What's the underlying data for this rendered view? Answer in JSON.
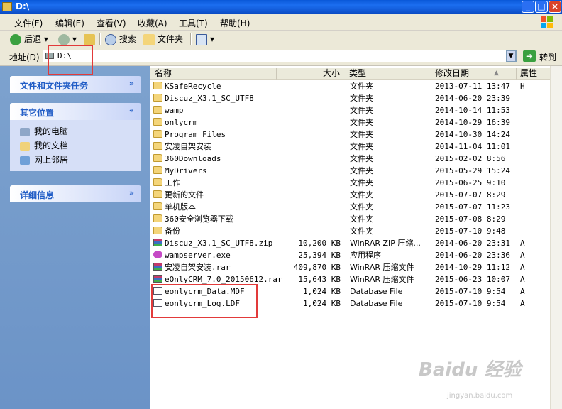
{
  "window": {
    "title": "D:\\"
  },
  "menu": {
    "items": [
      "文件(F)",
      "编辑(E)",
      "查看(V)",
      "收藏(A)",
      "工具(T)",
      "帮助(H)"
    ]
  },
  "toolbar": {
    "back": "后退",
    "search": "搜索",
    "folders": "文件夹"
  },
  "address": {
    "label": "地址(D)",
    "value": "D:\\",
    "go": "转到"
  },
  "tasks": {
    "file_tasks_title": "文件和文件夹任务",
    "other_places_title": "其它位置",
    "other_places": [
      "我的电脑",
      "我的文档",
      "网上邻居"
    ],
    "details_title": "详细信息"
  },
  "columns": {
    "name": "名称",
    "size": "大小",
    "type": "类型",
    "date": "修改日期",
    "attr": "属性"
  },
  "files": [
    {
      "name": "KSafeRecycle",
      "size": "",
      "type": "文件夹",
      "date": "2013-07-11 13:47",
      "attr": "H",
      "icon": "folder"
    },
    {
      "name": "Discuz_X3.1_SC_UTF8",
      "size": "",
      "type": "文件夹",
      "date": "2014-06-20 23:39",
      "attr": "",
      "icon": "folder"
    },
    {
      "name": "wamp",
      "size": "",
      "type": "文件夹",
      "date": "2014-10-14 11:53",
      "attr": "",
      "icon": "folder"
    },
    {
      "name": "onlycrm",
      "size": "",
      "type": "文件夹",
      "date": "2014-10-29 16:39",
      "attr": "",
      "icon": "folder"
    },
    {
      "name": "Program Files",
      "size": "",
      "type": "文件夹",
      "date": "2014-10-30 14:24",
      "attr": "",
      "icon": "folder"
    },
    {
      "name": "安凌自架安装",
      "size": "",
      "type": "文件夹",
      "date": "2014-11-04 11:01",
      "attr": "",
      "icon": "folder"
    },
    {
      "name": "360Downloads",
      "size": "",
      "type": "文件夹",
      "date": "2015-02-02 8:56",
      "attr": "",
      "icon": "folder"
    },
    {
      "name": "MyDrivers",
      "size": "",
      "type": "文件夹",
      "date": "2015-05-29 15:24",
      "attr": "",
      "icon": "folder"
    },
    {
      "name": "工作",
      "size": "",
      "type": "文件夹",
      "date": "2015-06-25 9:10",
      "attr": "",
      "icon": "folder"
    },
    {
      "name": "更新的文件",
      "size": "",
      "type": "文件夹",
      "date": "2015-07-07 8:29",
      "attr": "",
      "icon": "folder"
    },
    {
      "name": "单机版本",
      "size": "",
      "type": "文件夹",
      "date": "2015-07-07 11:23",
      "attr": "",
      "icon": "folder"
    },
    {
      "name": "360安全浏览器下载",
      "size": "",
      "type": "文件夹",
      "date": "2015-07-08 8:29",
      "attr": "",
      "icon": "folder"
    },
    {
      "name": "备份",
      "size": "",
      "type": "文件夹",
      "date": "2015-07-10 9:48",
      "attr": "",
      "icon": "folder"
    },
    {
      "name": "Discuz_X3.1_SC_UTF8.zip",
      "size": "10,200 KB",
      "type": "WinRAR ZIP 压缩...",
      "date": "2014-06-20 23:31",
      "attr": "A",
      "icon": "rar"
    },
    {
      "name": "wampserver.exe",
      "size": "25,394 KB",
      "type": "应用程序",
      "date": "2014-06-20 23:36",
      "attr": "A",
      "icon": "exe"
    },
    {
      "name": "安凌自架安装.rar",
      "size": "409,870 KB",
      "type": "WinRAR 压缩文件",
      "date": "2014-10-29 11:12",
      "attr": "A",
      "icon": "rar"
    },
    {
      "name": "eOnlyCRM_7.0_20150612.rar",
      "size": "15,643 KB",
      "type": "WinRAR 压缩文件",
      "date": "2015-06-23 10:07",
      "attr": "A",
      "icon": "rar"
    },
    {
      "name": "eonlycrm_Data.MDF",
      "size": "1,024 KB",
      "type": "Database File",
      "date": "2015-07-10 9:54",
      "attr": "A",
      "icon": "db"
    },
    {
      "name": "eonlycrm_Log.LDF",
      "size": "1,024 KB",
      "type": "Database File",
      "date": "2015-07-10 9:54",
      "attr": "A",
      "icon": "db"
    }
  ],
  "watermark": {
    "brand": "Baidu 经验",
    "url": "jingyan.baidu.com"
  }
}
